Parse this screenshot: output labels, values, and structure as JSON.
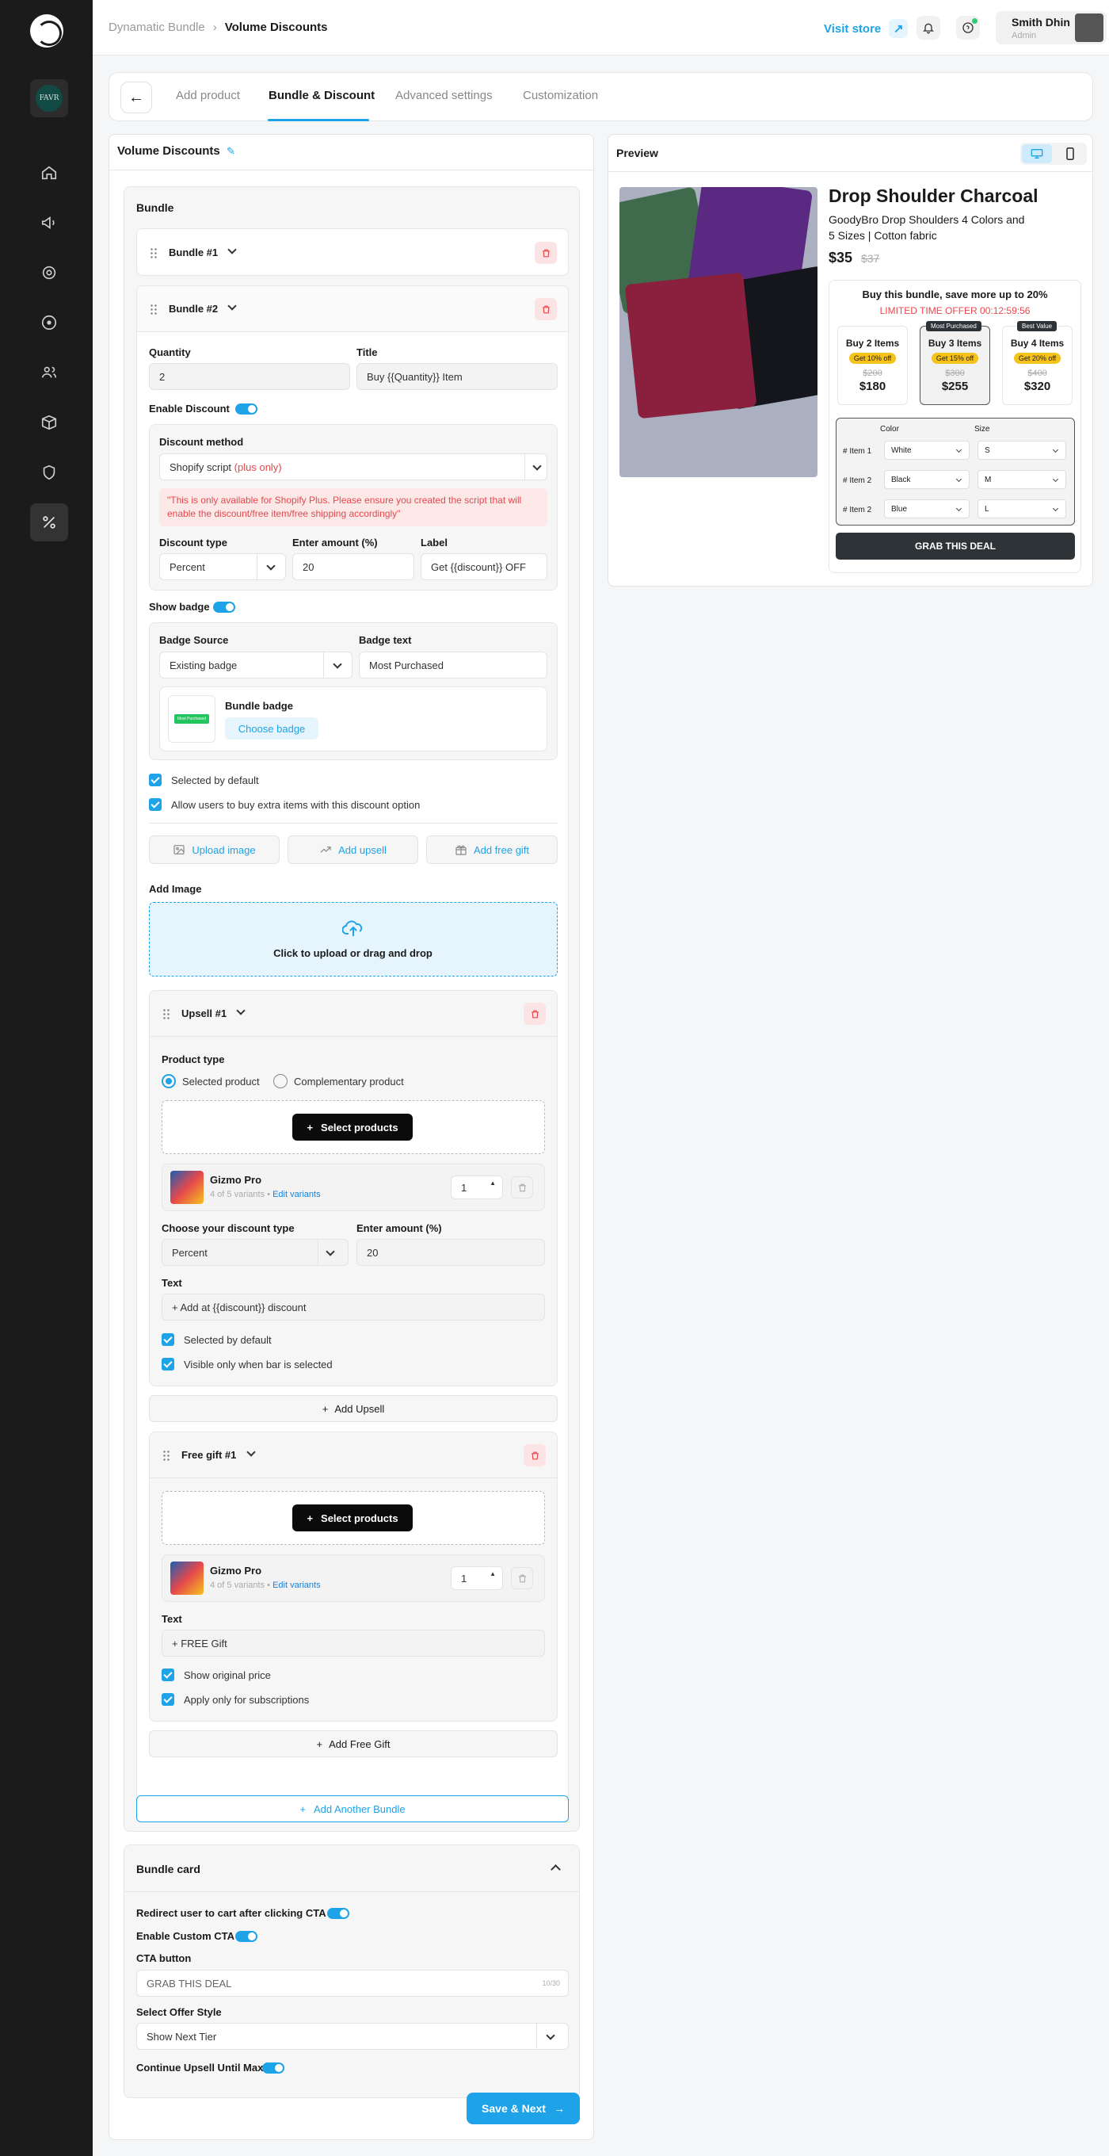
{
  "sidebar": {
    "brand": "FAVR",
    "icons": [
      "home-icon",
      "megaphone-icon",
      "target-icon",
      "play-circle-icon",
      "users-icon",
      "box-icon",
      "shield-icon",
      "discount-icon"
    ]
  },
  "topbar": {
    "breadcrumb_parent": "Dynamatic Bundle",
    "breadcrumb_current": "Volume Discounts",
    "visit_store": "Visit store",
    "user_name": "Smith Dhin",
    "user_role": "Admin"
  },
  "tabs": [
    "Add product",
    "Bundle & Discount",
    "Advanced settings",
    "Customization"
  ],
  "panel": {
    "title": "Volume Discounts"
  },
  "bundle": {
    "heading": "Bundle",
    "b1": "Bundle #1",
    "b2": "Bundle #2",
    "quantity_label": "Quantity",
    "quantity_value": "2",
    "title_label": "Title",
    "title_value": "Buy {{Quantity}} Item",
    "enable_discount": "Enable Discount",
    "discount_method_label": "Discount method",
    "discount_method_value": "Shopify script",
    "discount_method_tag": "(plus only)",
    "warning": "\"This is only available for Shopify Plus. Please ensure you created the script that will enable the discount/free item/free shipping accordingly\"",
    "discount_type_label": "Discount type",
    "discount_type_value": "Percent",
    "amount_label": "Enter amount (%)",
    "amount_value": "20",
    "label_label": "Label",
    "label_value": "Get {{discount}} OFF",
    "show_badge": "Show badge",
    "badge_source_label": "Badge Source",
    "badge_source_value": "Existing badge",
    "badge_text_label": "Badge text",
    "badge_text_value": "Most Purchased",
    "badge_preview": "Most Purchased",
    "bundle_badge": "Bundle badge",
    "choose_badge": "Choose badge",
    "selected_default": "Selected by default",
    "allow_extra": "Allow users to buy extra items with this discount option",
    "upload_image": "Upload image",
    "add_upsell_btn": "Add upsell",
    "add_free_gift_btn": "Add free gift",
    "add_image": "Add Image",
    "drop_text": "Click to upload or drag and drop"
  },
  "upsell": {
    "title": "Upsell #1",
    "product_type": "Product type",
    "opt1": "Selected product",
    "opt2": "Complementary product",
    "select_products": "Select products",
    "product_name": "Gizmo Pro",
    "variants": "4 of 5 variants",
    "edit_variants": "Edit variants",
    "qty": "1",
    "discount_type_label": "Choose your discount type",
    "discount_type_value": "Percent",
    "amount_label": "Enter amount (%)",
    "amount_value": "20",
    "text_label": "Text",
    "text_value": "+ Add at {{discount}} discount",
    "selected_default": "Selected by default",
    "visible_only": "Visible only when bar is selected",
    "add_upsell": "Add Upsell"
  },
  "gift": {
    "title": "Free gift #1",
    "select_products": "Select products",
    "product_name": "Gizmo Pro",
    "variants": "4 of 5 variants",
    "edit_variants": "Edit variants",
    "qty": "1",
    "text_label": "Text",
    "text_value": "+ FREE Gift",
    "show_original": "Show original price",
    "apply_subs": "Apply only for subscriptions",
    "add_free_gift": "Add Free Gift"
  },
  "add_another_bundle": "Add Another Bundle",
  "bundle_card": {
    "title": "Bundle card",
    "redirect": "Redirect user to cart after clicking CTA",
    "enable_custom_cta": "Enable Custom CTA",
    "cta_label": "CTA button",
    "cta_value": "GRAB THIS DEAL",
    "cta_counter": "10/30",
    "offer_style_label": "Select Offer Style",
    "offer_style_value": "Show Next Tier",
    "continue_upsell": "Continue Upsell Until Max"
  },
  "save_next": "Save & Next",
  "preview": {
    "title": "Preview",
    "product_title": "Drop Shoulder Charcoal",
    "desc_line1": "GoodyBro Drop Shoulders  4 Colors and",
    "desc_line2": "5 Sizes | Cotton fabric",
    "price": "$35",
    "compare": "$37",
    "headline": "Buy this bundle, save more up to 20%",
    "timer": "LIMITED TIME OFFER 00:12:59:56",
    "tiers": [
      {
        "title": "Buy 2 Items",
        "pill": "Get 10% off",
        "old": "$200",
        "new": "$180"
      },
      {
        "title": "Buy 3 Items",
        "pill": "Get 15% off",
        "old": "$300",
        "new": "$255",
        "ribbon": "Most Purchased"
      },
      {
        "title": "Buy 4 Items",
        "pill": "Get 20% off",
        "old": "$400",
        "new": "$320",
        "ribbon": "Best Value"
      }
    ],
    "color_hdr": "Color",
    "size_hdr": "Size",
    "items": [
      {
        "label": "# Item 1",
        "color": "White",
        "size": "S"
      },
      {
        "label": "# Item 2",
        "color": "Black",
        "size": "M"
      },
      {
        "label": "# Item 2",
        "color": "Blue",
        "size": "L"
      }
    ],
    "cta": "GRAB THIS DEAL"
  }
}
